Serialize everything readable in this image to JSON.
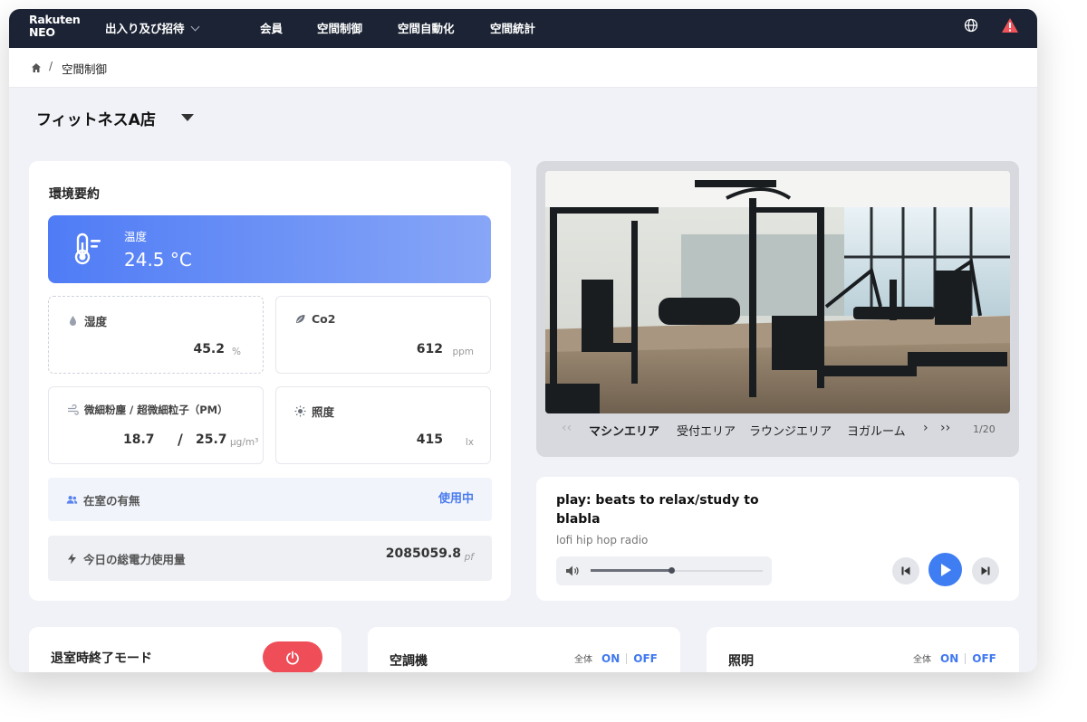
{
  "app": {
    "logo_line1": "Rakuten",
    "logo_line2": "NEO"
  },
  "nav": {
    "items": [
      {
        "label": "出入り及び招待",
        "has_dropdown": true
      },
      {
        "label": "会員"
      },
      {
        "label": "空間制御"
      },
      {
        "label": "空間自動化"
      },
      {
        "label": "空間統計"
      }
    ],
    "icons": [
      "globe-icon",
      "alert-icon"
    ],
    "alert_color": "#f0545a"
  },
  "breadcrumb": {
    "separator": "/",
    "current": "空間制御"
  },
  "store": {
    "selected": "フィットネスA店"
  },
  "environment": {
    "title": "環境要約",
    "temperature": {
      "label": "温度",
      "value": "24.5 °C"
    },
    "humidity": {
      "label": "湿度",
      "value": "45.2",
      "unit": "%"
    },
    "co2": {
      "label": "Co2",
      "value": "612",
      "unit": "ppm"
    },
    "pm": {
      "label": "微細粉塵 / 超微細粒子（PM）",
      "value1": "18.7",
      "separator": "/",
      "value2": "25.7",
      "unit": "μg/m³"
    },
    "illuminance": {
      "label": "照度",
      "value": "415",
      "unit": "lx"
    },
    "occupancy": {
      "label": "在室の有無",
      "status": "使用中"
    },
    "power": {
      "label": "今日の総電力使用量",
      "value": "2085059.8",
      "unit": "pf"
    },
    "accent": "#4f7cf6"
  },
  "gallery": {
    "tabs": [
      "マシンエリア",
      "受付エリア",
      "ラウンジエリア",
      "ヨガルーム"
    ],
    "active_tab": "マシンエリア",
    "page_indicator": "1/20",
    "prev_arrow": "‹‹",
    "next_arrow": "›",
    "last_arrow": "››"
  },
  "player": {
    "track": "play: beats to relax/study to blabla",
    "station": "lofi hip hop radio",
    "volume": 0.47,
    "play_color": "#3f7df3"
  },
  "bottom": {
    "exit_mode": {
      "label": "退室時終了モード",
      "button_color": "#ef4d57"
    },
    "aircon": {
      "label": "空調機",
      "all": "全体",
      "on": "ON",
      "off": "OFF"
    },
    "lighting": {
      "label": "照明",
      "all": "全体",
      "on": "ON",
      "off": "OFF"
    }
  }
}
